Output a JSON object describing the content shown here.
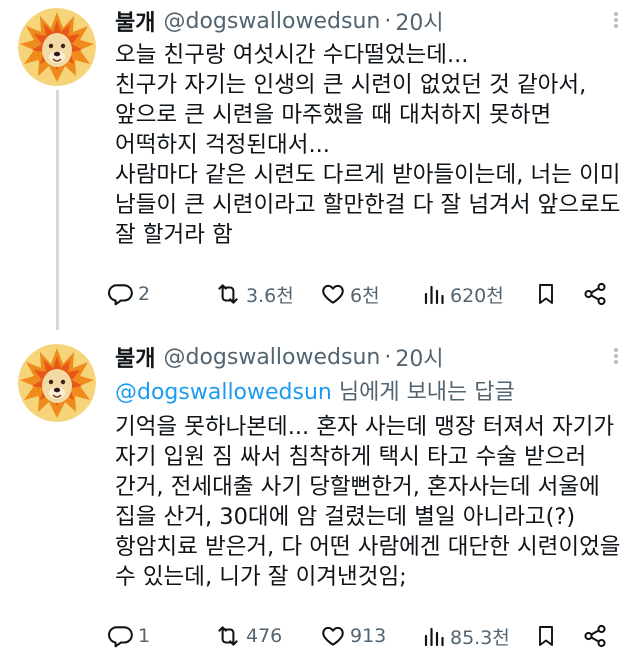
{
  "tweets": [
    {
      "name": "불개",
      "handle": "@dogswallowedsun",
      "time": "20시",
      "body": [
        "오늘 친구랑 여섯시간 수다떨었는데...",
        "친구가 자기는 인생의 큰 시련이 없었던 것 같아서,",
        "앞으로 큰 시련을 마주했을 때 대처하지 못하면",
        "어떡하지 걱정된대서...",
        "사람마다 같은 시련도 다르게 받아들이는데, 너는 이미",
        "남들이 큰 시련이라고 할만한걸 다 잘 넘겨서 앞으로도",
        "잘 할거라 함"
      ],
      "replies": "2",
      "retweets": "3.6천",
      "likes": "6천",
      "views": "620천"
    },
    {
      "name": "불개",
      "handle": "@dogswallowedsun",
      "time": "20시",
      "reply_to_handle": "@dogswallowedsun",
      "reply_to_suffix": " 님에게 보내는 답글",
      "body": [
        "기억을 못하나본데... 혼자 사는데 맹장 터져서 자기가",
        "자기 입원 짐 싸서 침착하게 택시 타고 수술 받으러",
        "간거, 전세대출 사기 당할뻔한거, 혼자사는데 서울에",
        "집을 산거, 30대에 암 걸렸는데 별일 아니라고(?)",
        "항암치료 받은거, 다 어떤 사람에겐 대단한 시련이었을",
        "수 있는데, 니가 잘 이겨낸것임;"
      ],
      "replies": "1",
      "retweets": "476",
      "likes": "913",
      "views": "85.3천"
    }
  ],
  "colors": {
    "text": "#0f1419",
    "muted": "#536471",
    "link": "#1d9bf0"
  },
  "icons": [
    "reply-icon",
    "retweet-icon",
    "like-icon",
    "views-icon",
    "bookmark-icon",
    "share-icon",
    "more-icon"
  ]
}
